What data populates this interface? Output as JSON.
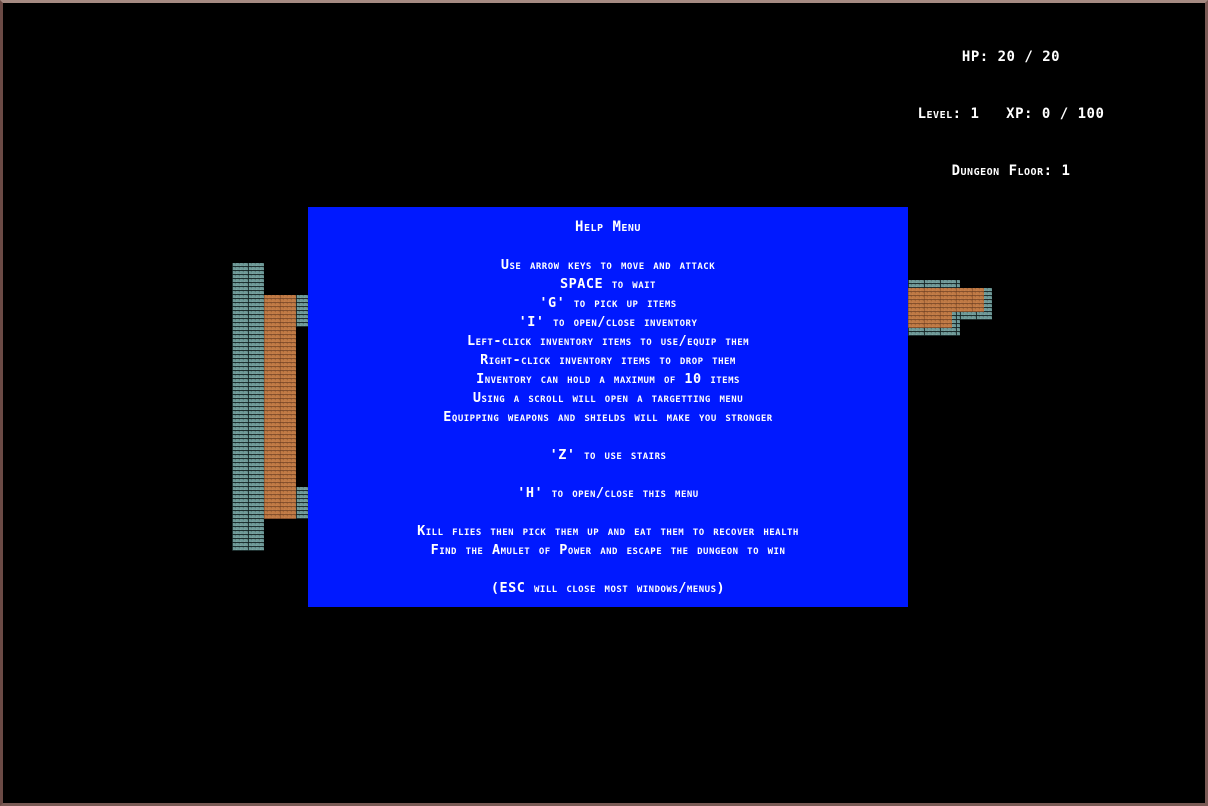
{
  "hud": {
    "hp": "HP: 20 / 20",
    "level_xp": "Level: 1   XP: 0 / 100",
    "floor": "Dungeon Floor: 1"
  },
  "help_menu": {
    "title": "Help Menu",
    "lines": [
      "Use arrow keys to move and attack",
      "SPACE to wait",
      "'G' to pick up items",
      "'I' to open/close inventory",
      "Left-click inventory items to use/equip them",
      "Right-click inventory items to drop them",
      "Inventory can hold a maximum of 10 items",
      "Using a scroll will open a targetting menu",
      "Equipping weapons and shields will make you stronger",
      "'Z' to use stairs",
      "'H' to open/close this menu",
      "Kill flies then pick them up and eat them to recover health",
      "Find the Amulet of Power and escape the dungeon to win",
      "(ESC will close most windows/menus)"
    ]
  },
  "colors": {
    "background": "#000000",
    "help_panel": "#0019ff",
    "text": "#ffffff",
    "wall": "#6f9a98",
    "floor": "#c07a45"
  }
}
